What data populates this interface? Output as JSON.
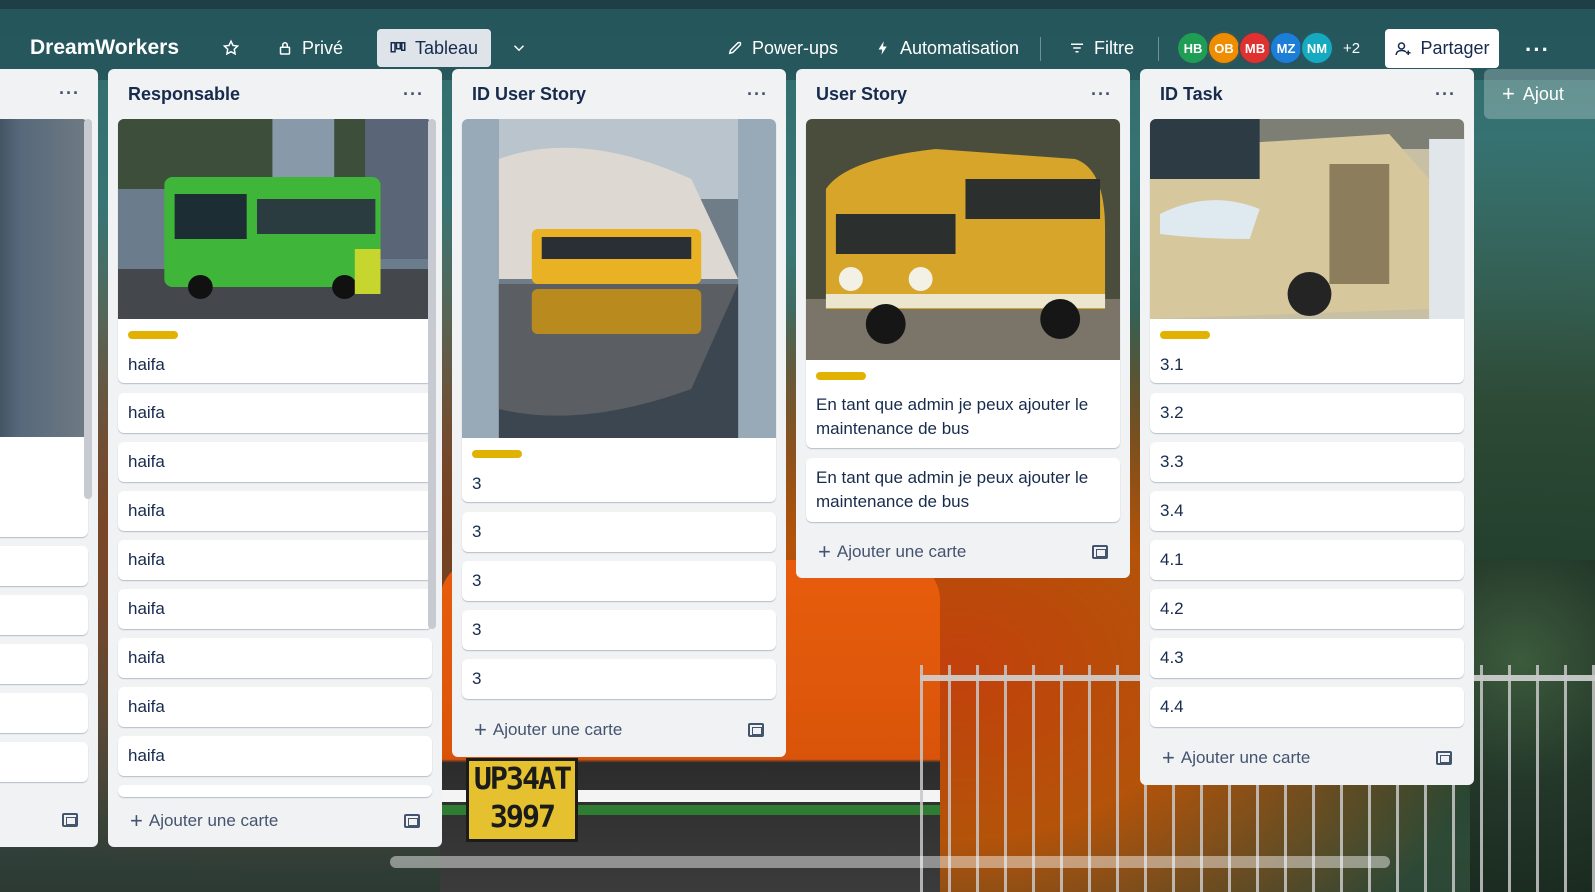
{
  "board": {
    "title": "DreamWorkers",
    "visibility": "Privé",
    "view": "Tableau",
    "powerups": "Power-ups",
    "automation": "Automatisation",
    "filter": "Filtre",
    "members": [
      "HB",
      "OB",
      "MB",
      "MZ",
      "NM"
    ],
    "member_colors": [
      "#1f9d55",
      "#f08c00",
      "#e03131",
      "#1c7ed6",
      "#15aabf"
    ],
    "more_members": "+2",
    "share": "Partager",
    "add_list": "Ajout"
  },
  "lists": {
    "responsable": {
      "title": "Responsable",
      "cards": [
        "haifa",
        "haifa",
        "haifa",
        "haifa",
        "haifa",
        "haifa",
        "haifa",
        "haifa",
        "haifa"
      ],
      "add": "Ajouter une carte"
    },
    "id_user_story": {
      "title": "ID User Story",
      "cards": [
        "3",
        "3",
        "3",
        "3",
        "3"
      ],
      "add": "Ajouter une carte"
    },
    "user_story": {
      "title": "User Story",
      "cards": [
        "En tant que admin je peux ajouter le maintenance de bus",
        "En tant que admin je peux ajouter le maintenance de bus"
      ],
      "add": "Ajouter une carte"
    },
    "id_task": {
      "title": "ID Task",
      "cards": [
        "3.1",
        "3.2",
        "3.3",
        "3.4",
        "4.1",
        "4.2",
        "4.3",
        "4.4"
      ],
      "add": "Ajouter une carte"
    }
  },
  "background": {
    "plate_line1": "UP34AT",
    "plate_line2": "3997"
  },
  "colors": {
    "label": "#e2b203",
    "list_bg": "#f1f2f4"
  }
}
